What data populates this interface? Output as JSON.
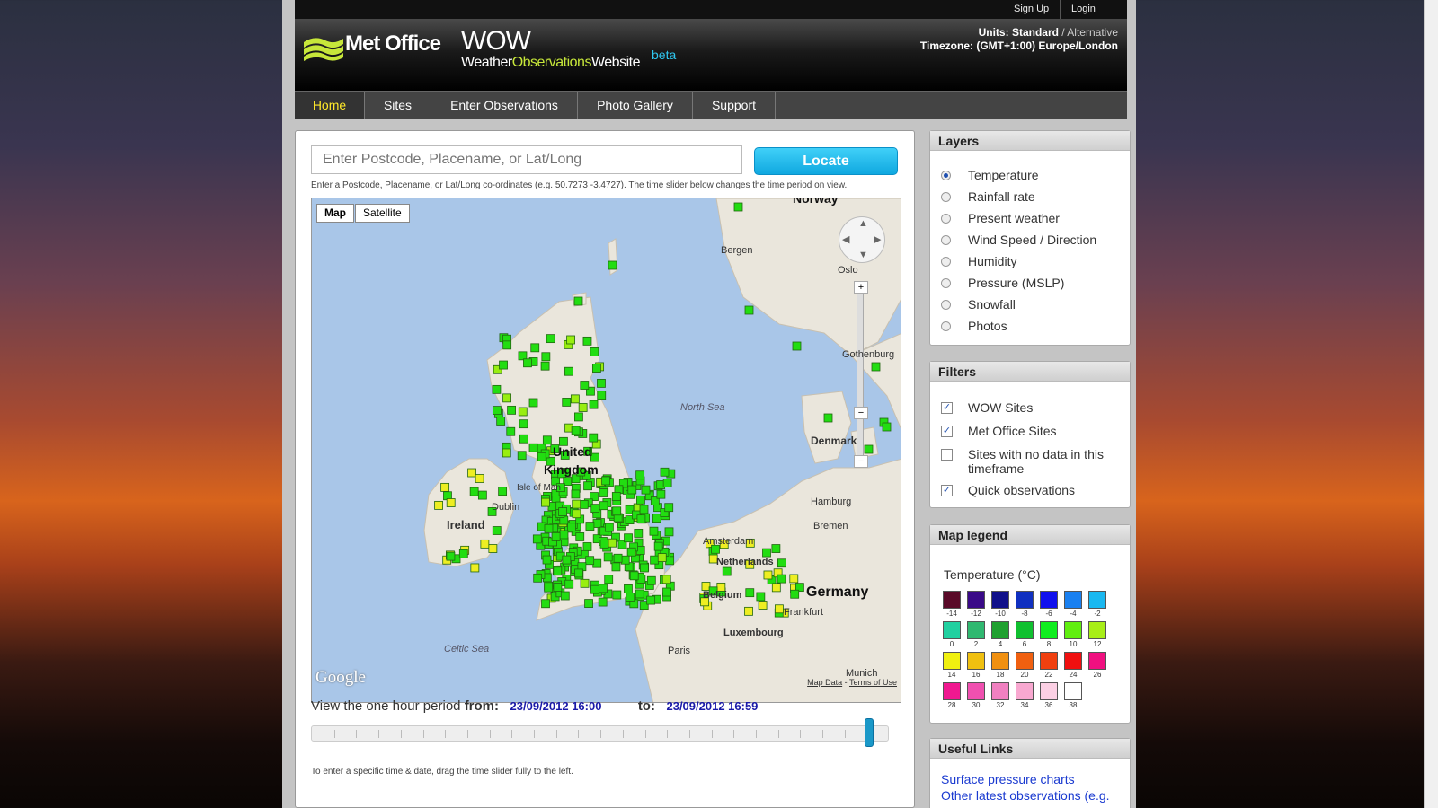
{
  "topbar": {
    "signup": "Sign Up",
    "login": "Login"
  },
  "header": {
    "logo": "Met Office",
    "wow_title": "WOW",
    "wow_sub_a": "Weather",
    "wow_sub_b": "Observations",
    "wow_sub_c": "Website",
    "beta": "beta",
    "units_label": "Units:",
    "units_standard": "Standard",
    "units_sep": " / ",
    "units_alternative": "Alternative",
    "timezone": "Timezone: (GMT+1:00) Europe/London"
  },
  "nav": {
    "items": [
      "Home",
      "Sites",
      "Enter Observations",
      "Photo Gallery",
      "Support"
    ],
    "active": "Home"
  },
  "search": {
    "placeholder": "Enter Postcode, Placename, or Lat/Long",
    "button": "Locate",
    "hint": "Enter a Postcode, Placename, or Lat/Long co-ordinates (e.g. 50.7273 -3.4727). The time slider below changes the time period on view."
  },
  "map": {
    "type_map": "Map",
    "type_satellite": "Satellite",
    "labels": {
      "norway": "Norway",
      "bergen": "Bergen",
      "oslo": "Oslo",
      "gothenburg": "Gothenburg",
      "north_sea": "North Sea",
      "denmark": "Denmark",
      "united_kingdom_a": "United",
      "united_kingdom_b": "Kingdom",
      "isle_of_man": "Isle of Man",
      "dublin": "Dublin",
      "ireland": "Ireland",
      "hamburg": "Hamburg",
      "bremen": "Bremen",
      "amsterdam": "Amsterdam",
      "netherlands": "Netherlands",
      "belgium": "Belgium",
      "germany": "Germany",
      "frankfurt": "Frankfurt",
      "luxembourg": "Luxembourg",
      "celtic_sea": "Celtic Sea",
      "paris": "Paris",
      "munich": "Munich"
    },
    "google": "Google",
    "map_data": "Map Data",
    "terms": "Terms of Use",
    "marker_colors": {
      "green": "#22dd11",
      "lime": "#99ee11",
      "yellow": "#eeee22"
    }
  },
  "time": {
    "label_a": "View the one hour period",
    "from_label": "from:",
    "from": "23/09/2012 16:00",
    "to_label": "to:",
    "to": "23/09/2012 16:59",
    "slider_hint": "To enter a specific time & date, drag the time slider fully to the left."
  },
  "layers": {
    "title": "Layers",
    "items": [
      "Temperature",
      "Rainfall rate",
      "Present weather",
      "Wind Speed / Direction",
      "Humidity",
      "Pressure (MSLP)",
      "Snowfall",
      "Photos"
    ],
    "selected": "Temperature"
  },
  "filters": {
    "title": "Filters",
    "items": [
      {
        "label": "WOW Sites",
        "checked": true
      },
      {
        "label": "Met Office Sites",
        "checked": true
      },
      {
        "label": "Sites with no data in this",
        "label2": "timeframe",
        "checked": false
      },
      {
        "label": "Quick observations",
        "checked": true
      }
    ]
  },
  "legend": {
    "title": "Map legend",
    "subtitle": "Temperature (°C)",
    "steps": [
      {
        "v": "-14",
        "c": "#5a0a28"
      },
      {
        "v": "-12",
        "c": "#3a0a88"
      },
      {
        "v": "-10",
        "c": "#10108a"
      },
      {
        "v": "-8",
        "c": "#1030c0"
      },
      {
        "v": "-6",
        "c": "#1010ee"
      },
      {
        "v": "-4",
        "c": "#1a80f0"
      },
      {
        "v": "-2",
        "c": "#1ab8f0"
      },
      {
        "v": "0",
        "c": "#20d0a0"
      },
      {
        "v": "2",
        "c": "#30b870"
      },
      {
        "v": "4",
        "c": "#20a030"
      },
      {
        "v": "6",
        "c": "#10c030"
      },
      {
        "v": "8",
        "c": "#10ee20"
      },
      {
        "v": "10",
        "c": "#60ee10"
      },
      {
        "v": "12",
        "c": "#a8ee18"
      },
      {
        "v": "14",
        "c": "#f0f010"
      },
      {
        "v": "16",
        "c": "#f0c010"
      },
      {
        "v": "18",
        "c": "#f09010"
      },
      {
        "v": "20",
        "c": "#f06010"
      },
      {
        "v": "22",
        "c": "#f04010"
      },
      {
        "v": "24",
        "c": "#f01010"
      },
      {
        "v": "26",
        "c": "#f01080"
      },
      {
        "v": "28",
        "c": "#f01890"
      },
      {
        "v": "30",
        "c": "#f050b0"
      },
      {
        "v": "32",
        "c": "#f080c0"
      },
      {
        "v": "34",
        "c": "#f8a8d0"
      },
      {
        "v": "36",
        "c": "#fcd0e4"
      },
      {
        "v": "38",
        "c": "#ffffff"
      }
    ]
  },
  "links": {
    "title": "Useful Links",
    "items": [
      "Surface pressure charts",
      "Other latest observations (e.g."
    ]
  }
}
